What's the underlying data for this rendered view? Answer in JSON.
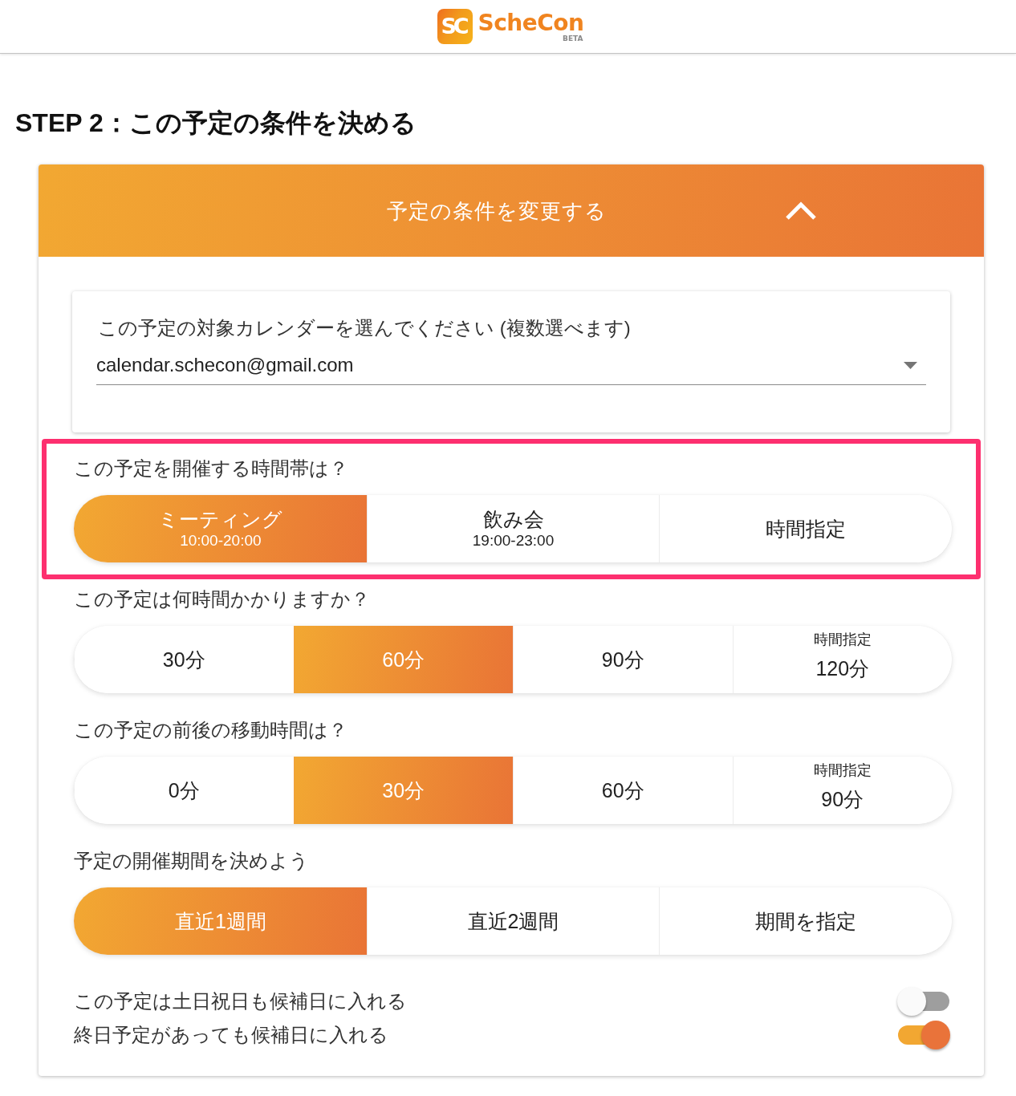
{
  "header": {
    "logo_mark": "SC",
    "logo_name": "ScheCon",
    "logo_badge": "BETA"
  },
  "step_title": "STEP 2：この予定の条件を決める",
  "panel": {
    "title": "予定の条件を変更する",
    "expanded": true
  },
  "calendar": {
    "label": "この予定の対象カレンダーを選んでください (複数選べます)",
    "value": "calendar.schecon@gmail.com"
  },
  "sections": [
    {
      "question": "この予定を開催する時間帯は？",
      "highlighted": true,
      "options": [
        {
          "label": "ミーティング",
          "sub": "10:00-20:00",
          "selected": true
        },
        {
          "label": "飲み会",
          "sub": "19:00-23:00",
          "selected": false
        },
        {
          "label": "時間指定",
          "selected": false
        }
      ]
    },
    {
      "question": "この予定は何時間かかりますか？",
      "highlighted": false,
      "options": [
        {
          "label": "30分",
          "selected": false
        },
        {
          "label": "60分",
          "selected": true
        },
        {
          "label": "90分",
          "selected": false
        },
        {
          "caption": "時間指定",
          "label": "120分",
          "selected": false
        }
      ]
    },
    {
      "question": "この予定の前後の移動時間は？",
      "highlighted": false,
      "options": [
        {
          "label": "0分",
          "selected": false
        },
        {
          "label": "30分",
          "selected": true
        },
        {
          "label": "60分",
          "selected": false
        },
        {
          "caption": "時間指定",
          "label": "90分",
          "selected": false
        }
      ]
    },
    {
      "question": "予定の開催期間を決めよう",
      "highlighted": false,
      "options": [
        {
          "label": "直近1週間",
          "selected": true
        },
        {
          "label": "直近2週間",
          "selected": false
        },
        {
          "label": "期間を指定",
          "selected": false
        }
      ]
    }
  ],
  "toggles": [
    {
      "label": "この予定は土日祝日も候補日に入れる",
      "on": false
    },
    {
      "label": "終日予定があっても候補日に入れる",
      "on": true
    }
  ]
}
